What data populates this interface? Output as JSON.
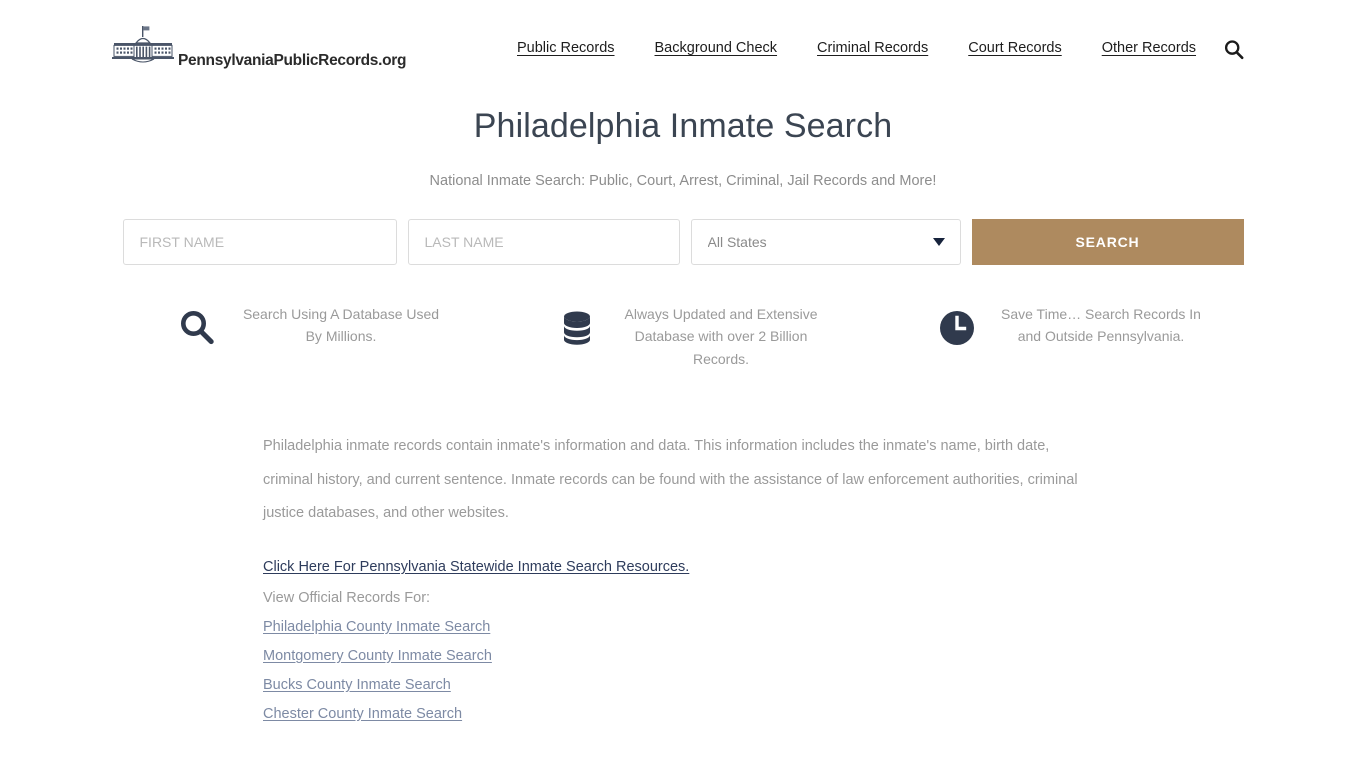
{
  "header": {
    "brand_name": "PennsylvaniaPublicRecords.org",
    "logo_icon": "capitol-building-icon",
    "nav": [
      {
        "label": "Public Records"
      },
      {
        "label": "Background Check"
      },
      {
        "label": "Criminal Records"
      },
      {
        "label": "Court Records"
      },
      {
        "label": "Other Records"
      }
    ],
    "search_icon": "search-icon"
  },
  "hero": {
    "title": "Philadelphia Inmate Search",
    "subtitle": "National Inmate Search: Public, Court, Arrest, Criminal, Jail Records and More!"
  },
  "search_form": {
    "first_name_placeholder": "FIRST NAME",
    "first_name_value": "",
    "last_name_placeholder": "LAST NAME",
    "last_name_value": "",
    "state_selected": "All States",
    "state_options": [
      "All States"
    ],
    "submit_label": "SEARCH",
    "submit_color": "#ae8a5f"
  },
  "features": [
    {
      "icon": "magnifier-icon",
      "text": "Search Using A Database Used By Millions."
    },
    {
      "icon": "database-icon",
      "text": "Always Updated and Extensive Database with over 2 Billion Records."
    },
    {
      "icon": "clock-icon",
      "text": "Save Time… Search Records In and Outside Pennsylvania."
    }
  ],
  "content": {
    "paragraph": "Philadelphia inmate records contain inmate's information and data. This information includes the inmate's name, birth date, criminal history, and current sentence. Inmate records can be found with the assistance of law enforcement authorities, criminal justice databases, and other websites.",
    "statewide_link": "Click Here For Pennsylvania Statewide Inmate Search Resources.",
    "view_official_label": "View Official Records For:",
    "county_links": [
      {
        "label": "Philadelphia County Inmate Search"
      },
      {
        "label": "Montgomery County Inmate Search"
      },
      {
        "label": "Bucks County Inmate Search"
      },
      {
        "label": "Chester County Inmate Search"
      }
    ]
  },
  "colors": {
    "title": "#3b4552",
    "accent": "#ae8a5f",
    "muted_text": "#9a9a9a",
    "link": "#7d8aa4",
    "dark_link": "#2e3c5c"
  }
}
